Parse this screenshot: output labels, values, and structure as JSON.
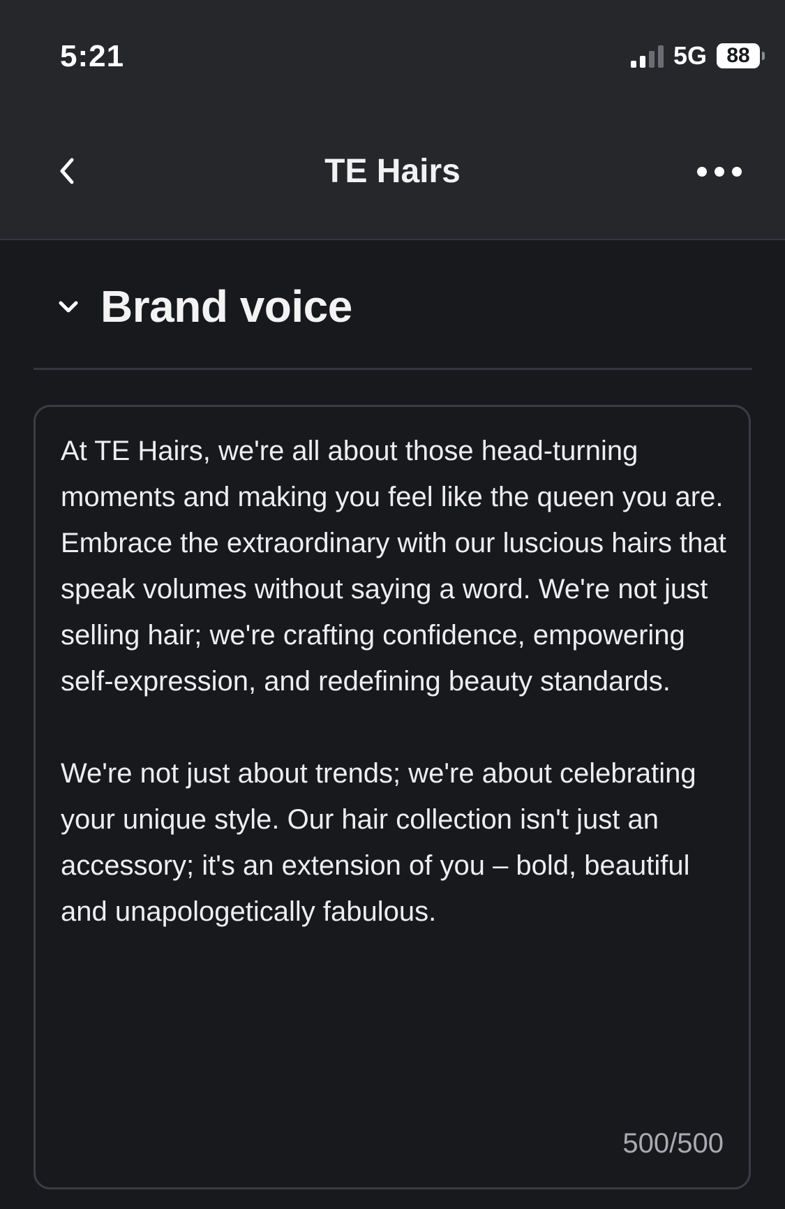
{
  "status_bar": {
    "time": "5:21",
    "network": "5G",
    "battery": "88"
  },
  "nav": {
    "title": "TE Hairs",
    "back_icon": "chevron-left-icon",
    "more_icon": "more-horizontal-icon"
  },
  "section": {
    "title": "Brand voice",
    "toggle_icon": "chevron-down-icon"
  },
  "brand_voice": {
    "text": "At TE Hairs, we're all about those head-turning moments and making you feel like the queen you are. Embrace the extraordinary with our luscious hairs that speak volumes without saying a word. We're not just selling hair; we're crafting confidence, empowering self-expression, and redefining beauty standards.\n\nWe're not just about trends; we're about celebrating your unique style. Our hair collection isn't just an accessory; it's an extension of you – bold, beautiful and unapologetically fabulous.",
    "counter": "500/500"
  },
  "colors": {
    "background": "#18191c",
    "header": "#25272b",
    "text": "#ececed",
    "muted": "#a9abb0"
  }
}
